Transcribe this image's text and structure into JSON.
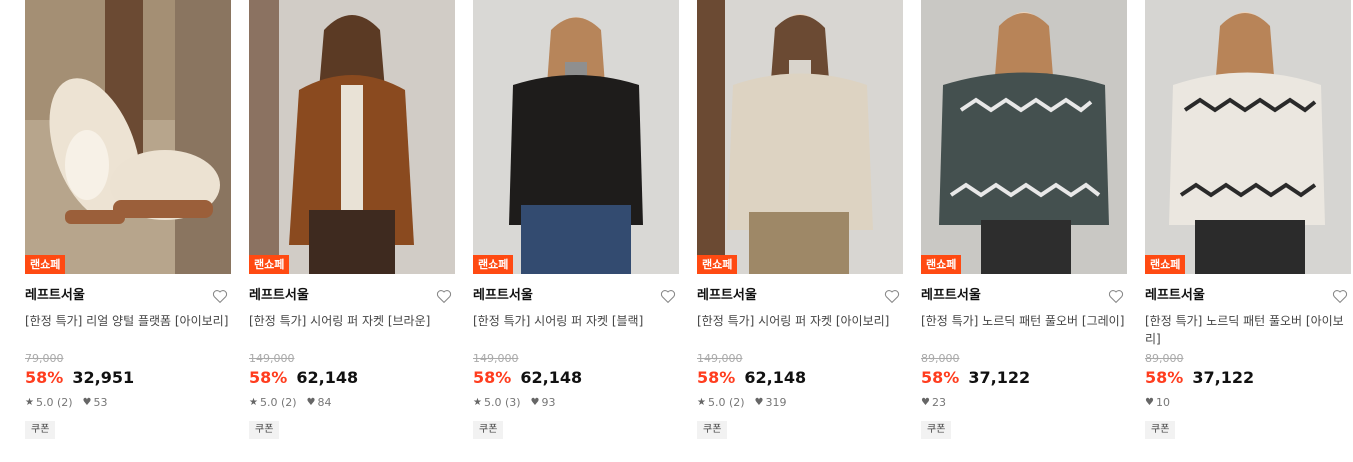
{
  "products": [
    {
      "badge": "랜쇼페",
      "brand": "레프트서울",
      "title": "[한정 특가] 리얼 양털 플랫폼 [아이보리]",
      "original_price": "79,000",
      "discount": "58%",
      "price": "32,951",
      "rating": "5.0 (2)",
      "likes": "53",
      "coupon": "쿠폰"
    },
    {
      "badge": "랜쇼페",
      "brand": "레프트서울",
      "title": "[한정 특가] 시어링 퍼 자켓 [브라운]",
      "original_price": "149,000",
      "discount": "58%",
      "price": "62,148",
      "rating": "5.0 (2)",
      "likes": "84",
      "coupon": "쿠폰"
    },
    {
      "badge": "랜쇼페",
      "brand": "레프트서울",
      "title": "[한정 특가] 시어링 퍼 자켓 [블랙]",
      "original_price": "149,000",
      "discount": "58%",
      "price": "62,148",
      "rating": "5.0 (3)",
      "likes": "93",
      "coupon": "쿠폰"
    },
    {
      "badge": "랜쇼페",
      "brand": "레프트서울",
      "title": "[한정 특가] 시어링 퍼 자켓 [아이보리]",
      "original_price": "149,000",
      "discount": "58%",
      "price": "62,148",
      "rating": "5.0 (2)",
      "likes": "319",
      "coupon": "쿠폰"
    },
    {
      "badge": "랜쇼페",
      "brand": "레프트서울",
      "title": "[한정 특가] 노르딕 패턴 풀오버 [그레이]",
      "original_price": "89,000",
      "discount": "58%",
      "price": "37,122",
      "rating": "",
      "likes": "23",
      "coupon": "쿠폰"
    },
    {
      "badge": "랜쇼페",
      "brand": "레프트서울",
      "title": "[한정 특가] 노르딕 패턴 풀오버 [아이보리]",
      "original_price": "89,000",
      "discount": "58%",
      "price": "37,122",
      "rating": "",
      "likes": "10",
      "coupon": "쿠폰"
    }
  ],
  "colors": {
    "badge": "#ff4a12",
    "discount": "#ff3d1f"
  },
  "icons": {
    "wishlist": "heart-outline-icon",
    "rating": "star-icon",
    "likes": "heart-filled-icon"
  }
}
